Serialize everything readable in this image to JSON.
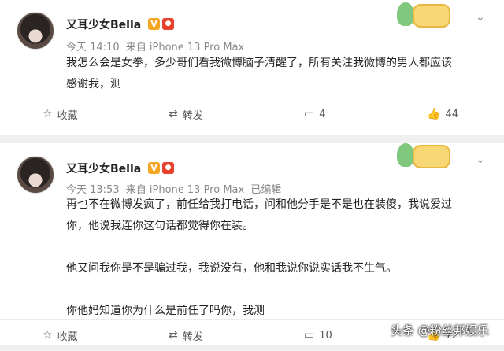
{
  "posts": [
    {
      "username": "又耳少女Bella",
      "badge_v": "V",
      "badge_m": "●",
      "time": "今天 14:10",
      "source": "来自 iPhone 13 Pro Max",
      "edited": "",
      "content": [
        "我怎么会是女拳，多少哥们看我微博脑子清醒了，所有关注我微博的男人都应该",
        "感谢我，测"
      ],
      "actions": {
        "favorite": "收藏",
        "repost": "转发",
        "comment": "4",
        "like": "44"
      }
    },
    {
      "username": "又耳少女Bella",
      "badge_v": "V",
      "badge_m": "●",
      "time": "今天 13:53",
      "source": "来自 iPhone 13 Pro Max",
      "edited": "已编辑",
      "content": [
        "再也不在微博发疯了，前任给我打电话，问和他分手是不是也在装傻，我说爱过",
        "你，他说我连你这句话都觉得你在装。",
        "",
        "他又问我你是不是骗过我，我说没有，他和我说你说实话我不生气。",
        "",
        "你他妈知道你为什么是前任了吗你，我测"
      ],
      "actions": {
        "favorite": "收藏",
        "repost": "转发",
        "comment": "10",
        "like": "72"
      }
    }
  ],
  "watermark": "头条 @粉丝邦娱乐",
  "colors": {
    "background": "#efefef",
    "card": "#ffffff",
    "text": "#222222",
    "meta": "#888888",
    "badge_v": "#f5a623",
    "badge_m": "#e8412c"
  },
  "icons": {
    "favorite": "star-icon",
    "repost": "repost-icon",
    "comment": "comment-icon",
    "like": "thumbs-up-icon",
    "menu": "chevron-down-icon"
  }
}
